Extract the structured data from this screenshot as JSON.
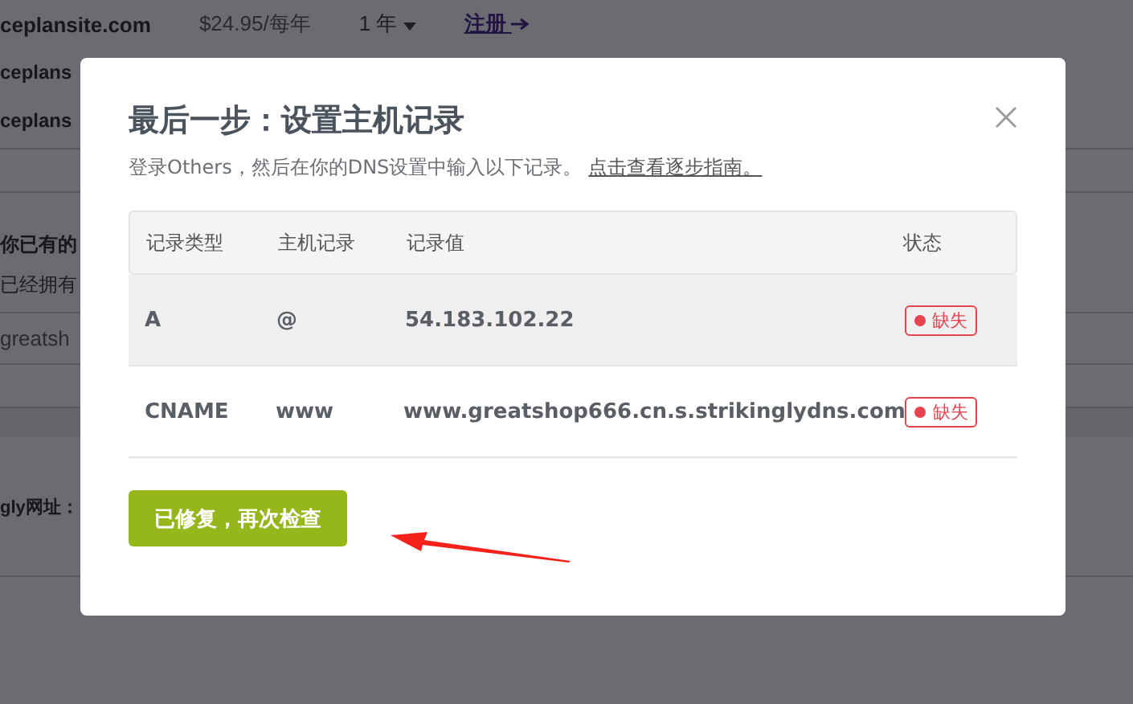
{
  "background_page": {
    "plan_row": {
      "domain": "ceplansite.com",
      "price": "$24.95/每年",
      "term": "1 年",
      "register_link": "注册"
    },
    "rows": [
      "ceplans",
      "ceplans"
    ],
    "section_title": "你已有的",
    "section_text": "已经拥有",
    "domain_field": "greatsh",
    "url_label": "gly网址："
  },
  "dialog": {
    "title": "最后一步：设置主机记录",
    "subtitle": "登录Others，然后在你的DNS设置中输入以下记录。",
    "guide_link": "点击查看逐步指南。",
    "table": {
      "columns": [
        "记录类型",
        "主机记录",
        "记录值",
        "状态"
      ],
      "rows": [
        {
          "type": "A",
          "host": "@",
          "value": "54.183.102.22",
          "status": "缺失",
          "highlighted": true
        },
        {
          "type": "CNAME",
          "host": "www",
          "value": "www.greatshop666.cn.s.strikinglydns.com",
          "status": "缺失",
          "highlighted": false
        }
      ]
    },
    "button": "已修复，再次检查"
  }
}
